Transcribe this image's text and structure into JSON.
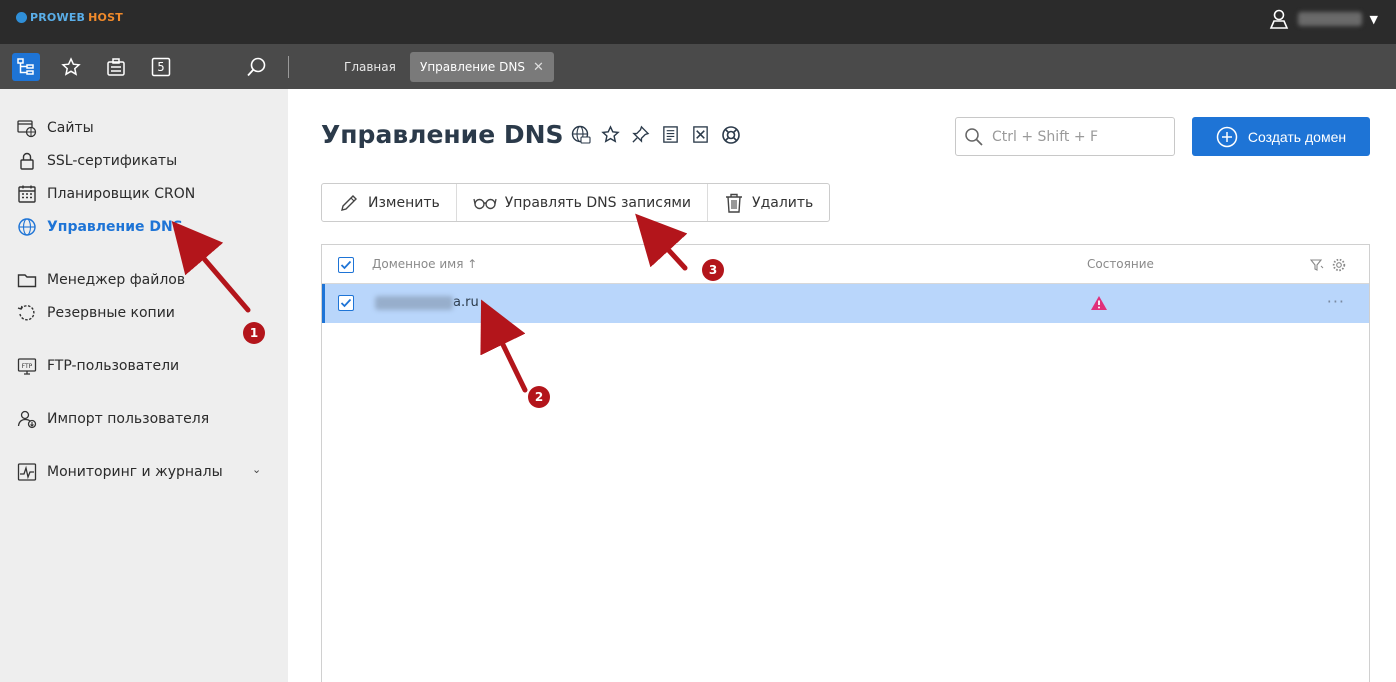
{
  "brand": {
    "part1": "PROWEB",
    "part2": "HOST"
  },
  "topbar": {
    "user_icon": "user-location-icon",
    "user_menu_icon": "chevron-down-icon"
  },
  "toolbar": {
    "icons": [
      "tree-icon",
      "star-icon",
      "clipboard-icon",
      "five-icon",
      "search-icon"
    ],
    "five_label": "5",
    "tabs": [
      {
        "label": "Главная"
      },
      {
        "label": "Управление DNS",
        "close": "✕"
      }
    ]
  },
  "sidebar": {
    "items": [
      {
        "label": "Сайты",
        "icon": "globe-window-icon"
      },
      {
        "label": "SSL-сертификаты",
        "icon": "lock-icon"
      },
      {
        "label": "Планировщик CRON",
        "icon": "calendar-icon"
      },
      {
        "label": "Управление DNS",
        "icon": "dns-globe-icon",
        "active": true
      },
      {
        "label": "Менеджер файлов",
        "icon": "folder-icon"
      },
      {
        "label": "Резервные копии",
        "icon": "backup-icon"
      },
      {
        "label": "FTP-пользователи",
        "icon": "ftp-icon"
      },
      {
        "label": "Импорт пользователя",
        "icon": "user-import-icon"
      },
      {
        "label": "Мониторинг и журналы",
        "icon": "monitor-icon"
      }
    ],
    "monitor_chevron": "⌄"
  },
  "main": {
    "title": "Управление DNS",
    "title_icons": [
      "dns-globe-icon",
      "star-icon",
      "pin-icon",
      "doc-icon",
      "flag-doc-icon",
      "lifebuoy-icon"
    ],
    "search": {
      "placeholder": "Ctrl + Shift + F"
    },
    "create_button": "Создать домен",
    "actions": [
      {
        "label": "Изменить",
        "icon": "pencil-icon"
      },
      {
        "label": "Управлять DNS записями",
        "icon": "glasses-icon"
      },
      {
        "label": "Удалить",
        "icon": "trash-icon"
      }
    ],
    "table": {
      "columns": {
        "domain": "Доменное имя",
        "sort": "↑",
        "state": "Состояние"
      },
      "header_icons": [
        "filter-icon",
        "gear-icon"
      ],
      "rows": [
        {
          "domain_suffix": "a.ru",
          "state_icon": "warning-icon",
          "menu": "···"
        }
      ]
    }
  },
  "annotations": [
    "1",
    "2",
    "3"
  ],
  "colors": {
    "accent": "#1e74d6",
    "annotation": "#b3151b",
    "selected_row": "#b9d6fb",
    "warning": "#e0307a"
  }
}
